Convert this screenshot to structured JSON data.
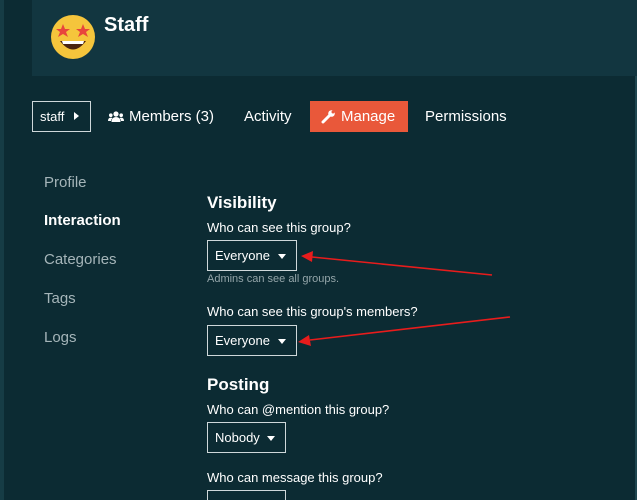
{
  "group": {
    "name": "Staff",
    "avatar_icon": "star-struck-emoji-icon"
  },
  "nav": {
    "crumb_label": "staff",
    "tabs": [
      {
        "label": "Members (3)",
        "icon": "users-icon"
      },
      {
        "label": "Activity"
      },
      {
        "label": "Manage",
        "icon": "wrench-icon",
        "active": true
      },
      {
        "label": "Permissions"
      }
    ]
  },
  "sidebar": {
    "items": [
      {
        "label": "Profile"
      },
      {
        "label": "Interaction",
        "active": true
      },
      {
        "label": "Categories"
      },
      {
        "label": "Tags"
      },
      {
        "label": "Logs"
      }
    ]
  },
  "visibility": {
    "heading": "Visibility",
    "see_group_label": "Who can see this group?",
    "see_group_value": "Everyone",
    "see_group_hint": "Admins can see all groups.",
    "see_members_label": "Who can see this group's members?",
    "see_members_value": "Everyone"
  },
  "posting": {
    "heading": "Posting",
    "mention_label": "Who can @mention this group?",
    "mention_value": "Nobody",
    "message_label": "Who can message this group?"
  },
  "colors": {
    "background": "#0c2b33",
    "header": "#123640",
    "accent": "#e9583a",
    "annotation_arrow": "#e81c1c"
  }
}
